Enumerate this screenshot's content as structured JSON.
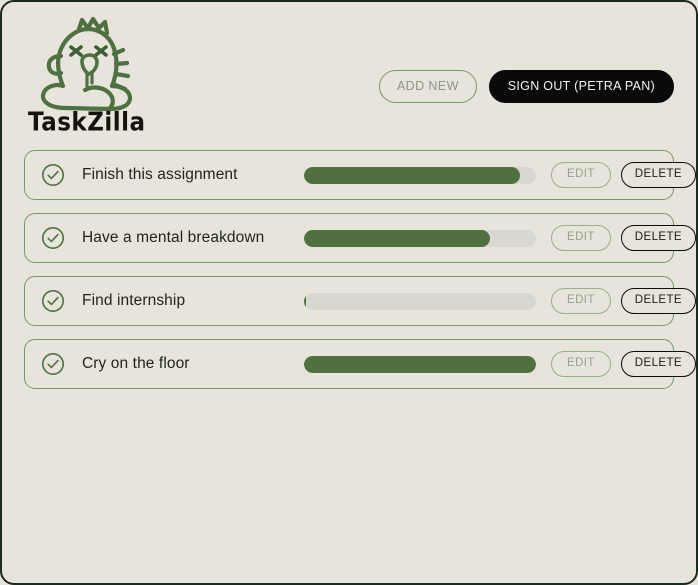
{
  "app": {
    "name": "TaskZilla",
    "logo_icon": "dinosaur-logo-icon",
    "background_color": "#e7e4db",
    "accent_color": "#51703f",
    "border_color": "#7e9470"
  },
  "header": {
    "add_new_label": "ADD NEW",
    "sign_out_label": "SIGN OUT (PETRA PAN)",
    "user_name": "PETRA PAN"
  },
  "row_actions": {
    "edit_label": "EDIT",
    "delete_label": "DELETE"
  },
  "tasks": [
    {
      "title": "Finish this assignment",
      "status_icon": "check-circle-icon",
      "progress": 93
    },
    {
      "title": "Have a mental breakdown",
      "status_icon": "check-circle-icon",
      "progress": 80
    },
    {
      "title": "Find internship",
      "status_icon": "check-circle-icon",
      "progress": 1
    },
    {
      "title": "Cry on the floor",
      "status_icon": "check-circle-icon",
      "progress": 100
    }
  ]
}
